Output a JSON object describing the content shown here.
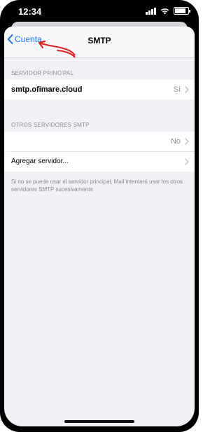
{
  "status_bar": {
    "time": "12:34"
  },
  "navbar": {
    "back_label": "Cuenta",
    "title": "SMTP"
  },
  "primary_server": {
    "header": "SERVIDOR PRINCIPAL",
    "host": "smtp.ofimare.cloud",
    "status": "Sí"
  },
  "other_servers": {
    "header": "OTROS SERVIDORES SMTP",
    "row_status": "No",
    "add_label": "Agregar servidor...",
    "footnote": "Si no se puede usar el servidor principal, Mail intentará usar los otros servidores SMTP sucesivamente."
  },
  "colors": {
    "accent": "#1a7cf5",
    "annotation": "#e01f1f"
  }
}
